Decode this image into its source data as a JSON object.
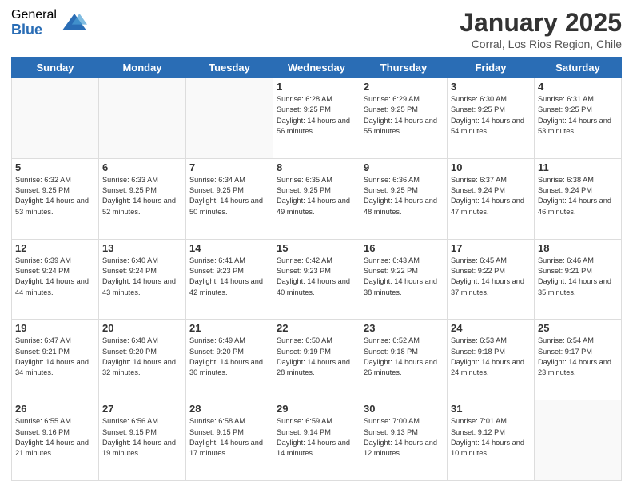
{
  "logo": {
    "general": "General",
    "blue": "Blue"
  },
  "title": "January 2025",
  "location": "Corral, Los Rios Region, Chile",
  "days_of_week": [
    "Sunday",
    "Monday",
    "Tuesday",
    "Wednesday",
    "Thursday",
    "Friday",
    "Saturday"
  ],
  "weeks": [
    [
      {
        "day": "",
        "sunrise": "",
        "sunset": "",
        "daylight": ""
      },
      {
        "day": "",
        "sunrise": "",
        "sunset": "",
        "daylight": ""
      },
      {
        "day": "",
        "sunrise": "",
        "sunset": "",
        "daylight": ""
      },
      {
        "day": "1",
        "sunrise": "Sunrise: 6:28 AM",
        "sunset": "Sunset: 9:25 PM",
        "daylight": "Daylight: 14 hours and 56 minutes."
      },
      {
        "day": "2",
        "sunrise": "Sunrise: 6:29 AM",
        "sunset": "Sunset: 9:25 PM",
        "daylight": "Daylight: 14 hours and 55 minutes."
      },
      {
        "day": "3",
        "sunrise": "Sunrise: 6:30 AM",
        "sunset": "Sunset: 9:25 PM",
        "daylight": "Daylight: 14 hours and 54 minutes."
      },
      {
        "day": "4",
        "sunrise": "Sunrise: 6:31 AM",
        "sunset": "Sunset: 9:25 PM",
        "daylight": "Daylight: 14 hours and 53 minutes."
      }
    ],
    [
      {
        "day": "5",
        "sunrise": "Sunrise: 6:32 AM",
        "sunset": "Sunset: 9:25 PM",
        "daylight": "Daylight: 14 hours and 53 minutes."
      },
      {
        "day": "6",
        "sunrise": "Sunrise: 6:33 AM",
        "sunset": "Sunset: 9:25 PM",
        "daylight": "Daylight: 14 hours and 52 minutes."
      },
      {
        "day": "7",
        "sunrise": "Sunrise: 6:34 AM",
        "sunset": "Sunset: 9:25 PM",
        "daylight": "Daylight: 14 hours and 50 minutes."
      },
      {
        "day": "8",
        "sunrise": "Sunrise: 6:35 AM",
        "sunset": "Sunset: 9:25 PM",
        "daylight": "Daylight: 14 hours and 49 minutes."
      },
      {
        "day": "9",
        "sunrise": "Sunrise: 6:36 AM",
        "sunset": "Sunset: 9:25 PM",
        "daylight": "Daylight: 14 hours and 48 minutes."
      },
      {
        "day": "10",
        "sunrise": "Sunrise: 6:37 AM",
        "sunset": "Sunset: 9:24 PM",
        "daylight": "Daylight: 14 hours and 47 minutes."
      },
      {
        "day": "11",
        "sunrise": "Sunrise: 6:38 AM",
        "sunset": "Sunset: 9:24 PM",
        "daylight": "Daylight: 14 hours and 46 minutes."
      }
    ],
    [
      {
        "day": "12",
        "sunrise": "Sunrise: 6:39 AM",
        "sunset": "Sunset: 9:24 PM",
        "daylight": "Daylight: 14 hours and 44 minutes."
      },
      {
        "day": "13",
        "sunrise": "Sunrise: 6:40 AM",
        "sunset": "Sunset: 9:24 PM",
        "daylight": "Daylight: 14 hours and 43 minutes."
      },
      {
        "day": "14",
        "sunrise": "Sunrise: 6:41 AM",
        "sunset": "Sunset: 9:23 PM",
        "daylight": "Daylight: 14 hours and 42 minutes."
      },
      {
        "day": "15",
        "sunrise": "Sunrise: 6:42 AM",
        "sunset": "Sunset: 9:23 PM",
        "daylight": "Daylight: 14 hours and 40 minutes."
      },
      {
        "day": "16",
        "sunrise": "Sunrise: 6:43 AM",
        "sunset": "Sunset: 9:22 PM",
        "daylight": "Daylight: 14 hours and 38 minutes."
      },
      {
        "day": "17",
        "sunrise": "Sunrise: 6:45 AM",
        "sunset": "Sunset: 9:22 PM",
        "daylight": "Daylight: 14 hours and 37 minutes."
      },
      {
        "day": "18",
        "sunrise": "Sunrise: 6:46 AM",
        "sunset": "Sunset: 9:21 PM",
        "daylight": "Daylight: 14 hours and 35 minutes."
      }
    ],
    [
      {
        "day": "19",
        "sunrise": "Sunrise: 6:47 AM",
        "sunset": "Sunset: 9:21 PM",
        "daylight": "Daylight: 14 hours and 34 minutes."
      },
      {
        "day": "20",
        "sunrise": "Sunrise: 6:48 AM",
        "sunset": "Sunset: 9:20 PM",
        "daylight": "Daylight: 14 hours and 32 minutes."
      },
      {
        "day": "21",
        "sunrise": "Sunrise: 6:49 AM",
        "sunset": "Sunset: 9:20 PM",
        "daylight": "Daylight: 14 hours and 30 minutes."
      },
      {
        "day": "22",
        "sunrise": "Sunrise: 6:50 AM",
        "sunset": "Sunset: 9:19 PM",
        "daylight": "Daylight: 14 hours and 28 minutes."
      },
      {
        "day": "23",
        "sunrise": "Sunrise: 6:52 AM",
        "sunset": "Sunset: 9:18 PM",
        "daylight": "Daylight: 14 hours and 26 minutes."
      },
      {
        "day": "24",
        "sunrise": "Sunrise: 6:53 AM",
        "sunset": "Sunset: 9:18 PM",
        "daylight": "Daylight: 14 hours and 24 minutes."
      },
      {
        "day": "25",
        "sunrise": "Sunrise: 6:54 AM",
        "sunset": "Sunset: 9:17 PM",
        "daylight": "Daylight: 14 hours and 23 minutes."
      }
    ],
    [
      {
        "day": "26",
        "sunrise": "Sunrise: 6:55 AM",
        "sunset": "Sunset: 9:16 PM",
        "daylight": "Daylight: 14 hours and 21 minutes."
      },
      {
        "day": "27",
        "sunrise": "Sunrise: 6:56 AM",
        "sunset": "Sunset: 9:15 PM",
        "daylight": "Daylight: 14 hours and 19 minutes."
      },
      {
        "day": "28",
        "sunrise": "Sunrise: 6:58 AM",
        "sunset": "Sunset: 9:15 PM",
        "daylight": "Daylight: 14 hours and 17 minutes."
      },
      {
        "day": "29",
        "sunrise": "Sunrise: 6:59 AM",
        "sunset": "Sunset: 9:14 PM",
        "daylight": "Daylight: 14 hours and 14 minutes."
      },
      {
        "day": "30",
        "sunrise": "Sunrise: 7:00 AM",
        "sunset": "Sunset: 9:13 PM",
        "daylight": "Daylight: 14 hours and 12 minutes."
      },
      {
        "day": "31",
        "sunrise": "Sunrise: 7:01 AM",
        "sunset": "Sunset: 9:12 PM",
        "daylight": "Daylight: 14 hours and 10 minutes."
      },
      {
        "day": "",
        "sunrise": "",
        "sunset": "",
        "daylight": ""
      }
    ]
  ]
}
